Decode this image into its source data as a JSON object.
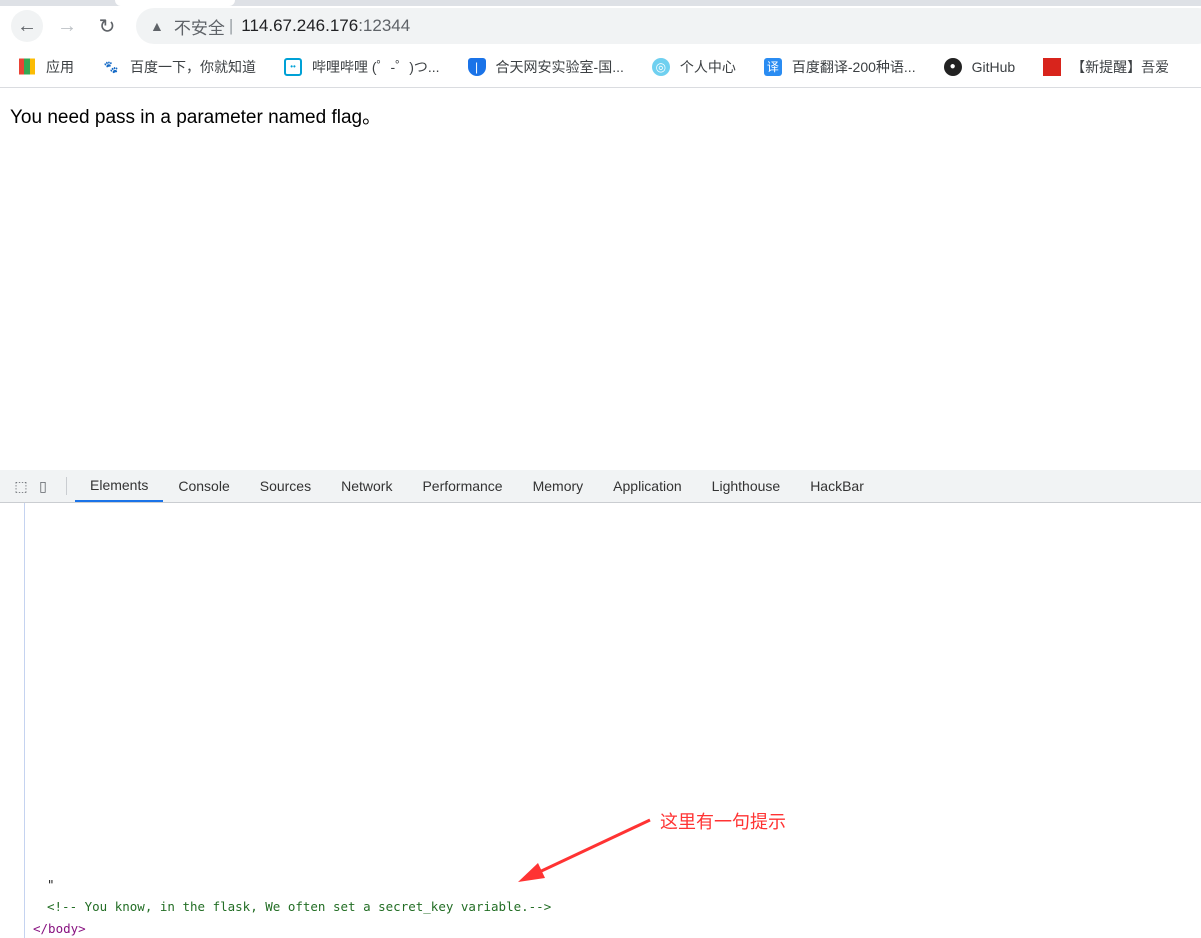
{
  "browser": {
    "back_icon": "arrow-left",
    "forward_icon": "arrow-right",
    "reload_icon": "reload",
    "security_label": "不安全",
    "url_host": "114.67.246.176",
    "url_port": ":12344",
    "bookmarks": [
      {
        "label": "应用",
        "icon": "apps-grid"
      },
      {
        "label": "百度一下，你就知道",
        "icon": "baidu-paw"
      },
      {
        "label": "哔哩哔哩 (゜-゜)つ...",
        "icon": "bilibili-tv"
      },
      {
        "label": "合天网安实验室-国...",
        "icon": "shield"
      },
      {
        "label": "个人中心",
        "icon": "globe"
      },
      {
        "label": "百度翻译-200种语...",
        "icon": "translate"
      },
      {
        "label": "GitHub",
        "icon": "github"
      },
      {
        "label": "【新提醒】吾爱",
        "icon": "52pojie"
      }
    ]
  },
  "page": {
    "message": "You need pass in a parameter named flag。"
  },
  "devtools": {
    "tabs": [
      "Elements",
      "Console",
      "Sources",
      "Network",
      "Performance",
      "Memory",
      "Application",
      "Lighthouse",
      "HackBar"
    ],
    "active_tab": "Elements",
    "lines": {
      "quote": "\"",
      "comment": "<!-- You know, in the flask, We often set a secret_key variable.-->",
      "body_close": "</body>"
    }
  },
  "annotation": {
    "text": "这里有一句提示",
    "color": "#ff3333"
  }
}
